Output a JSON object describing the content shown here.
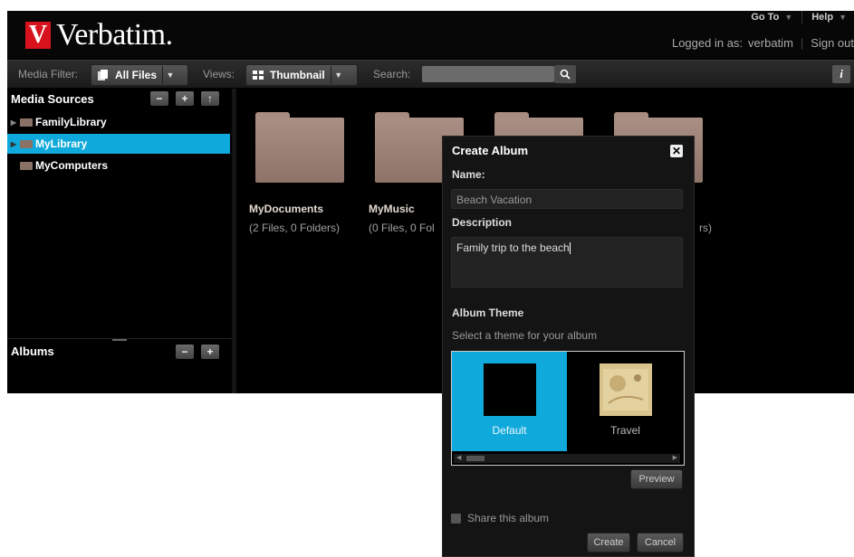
{
  "brand": {
    "logo_mark": "V",
    "name": "Verbatim."
  },
  "topnav": [
    {
      "label": "Go To",
      "has_caret": true
    },
    {
      "label": "Help",
      "has_caret": true
    }
  ],
  "user": {
    "logged_in_label": "Logged in as:",
    "username": "verbatim",
    "signout": "Sign out"
  },
  "toolbar": {
    "media_filter_label": "Media Filter:",
    "media_filter_value": "All Files",
    "views_label": "Views:",
    "views_value": "Thumbnail",
    "search_label": "Search:",
    "search_value": "",
    "info_icon": "i"
  },
  "sidebar": {
    "media_sources_title": "Media Sources",
    "media_sources_buttons": [
      "−",
      "+",
      "↑"
    ],
    "tree": [
      {
        "label": "FamilyLibrary",
        "selected": false,
        "expandable": true
      },
      {
        "label": "MyLibrary",
        "selected": true,
        "expandable": true
      },
      {
        "label": "MyComputers",
        "selected": false,
        "expandable": false
      }
    ],
    "albums_title": "Albums",
    "albums_buttons": [
      "−",
      "+"
    ]
  },
  "folders": [
    {
      "name": "MyDocuments",
      "info": "(2 Files, 0 Folders)"
    },
    {
      "name": "MyMusic",
      "info": "(0 Files, 0 Fol"
    },
    {
      "name": "",
      "info": ""
    },
    {
      "name": "",
      "info": "rs)"
    }
  ],
  "dialog": {
    "title": "Create Album",
    "close_icon": "✕",
    "name_label": "Name:",
    "name_placeholder": "Beach Vacation",
    "description_label": "Description",
    "description_value": "Family trip to the beach",
    "theme_label": "Album Theme",
    "theme_hint": "Select a theme for your album",
    "themes": [
      {
        "name": "Default",
        "selected": true,
        "color": "#000000"
      },
      {
        "name": "Travel",
        "selected": false,
        "color": "#d9c48e"
      }
    ],
    "preview_label": "Preview",
    "share_label": "Share this album",
    "share_checked": false,
    "create_label": "Create",
    "cancel_label": "Cancel"
  },
  "colors": {
    "accent": "#10a9dc",
    "brand_red": "#d8121c",
    "folder": "#a48a7e"
  }
}
